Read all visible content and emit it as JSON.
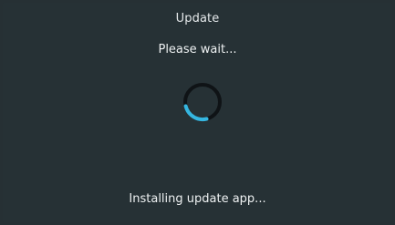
{
  "dialog": {
    "title": "Update",
    "message": "Please wait...",
    "status": "Installing update app..."
  },
  "spinner": {
    "icon": "loading-spinner-icon",
    "ring_color": "#0f1316",
    "accent_color": "#35b6e0"
  },
  "colors": {
    "background": "#263034",
    "text": "#eef1f2"
  }
}
